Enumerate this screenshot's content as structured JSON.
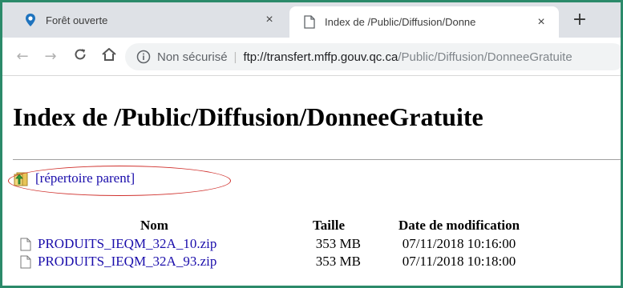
{
  "tabs": [
    {
      "title": "Forêt ouverte",
      "close": "×",
      "active": false
    },
    {
      "title": "Index de /Public/Diffusion/Donne",
      "close": "×",
      "active": true
    }
  ],
  "new_tab_label": "+",
  "toolbar": {
    "back": "←",
    "forward": "→",
    "reload": "C",
    "home": "⌂",
    "security_label": "Non sécurisé",
    "separator": "|",
    "url_host": "ftp://transfert.mffp.gouv.qc.ca",
    "url_path": "/Public/Diffusion/DonneeGratuite"
  },
  "page": {
    "title": "Index de /Public/Diffusion/DonneeGratuite",
    "parent_link": "[répertoire parent]",
    "columns": {
      "name": "Nom",
      "size": "Taille",
      "date": "Date de modification"
    },
    "files": [
      {
        "name": "PRODUITS_IEQM_32A_10.zip",
        "size": "353 MB",
        "date": "07/11/2018 10:16:00"
      },
      {
        "name": "PRODUITS_IEQM_32A_93.zip",
        "size": "353 MB",
        "date": "07/11/2018 10:18:00"
      }
    ]
  },
  "colors": {
    "link": "#1a0dab",
    "annotation": "#d0312d",
    "frame": "#2b8a6a"
  }
}
